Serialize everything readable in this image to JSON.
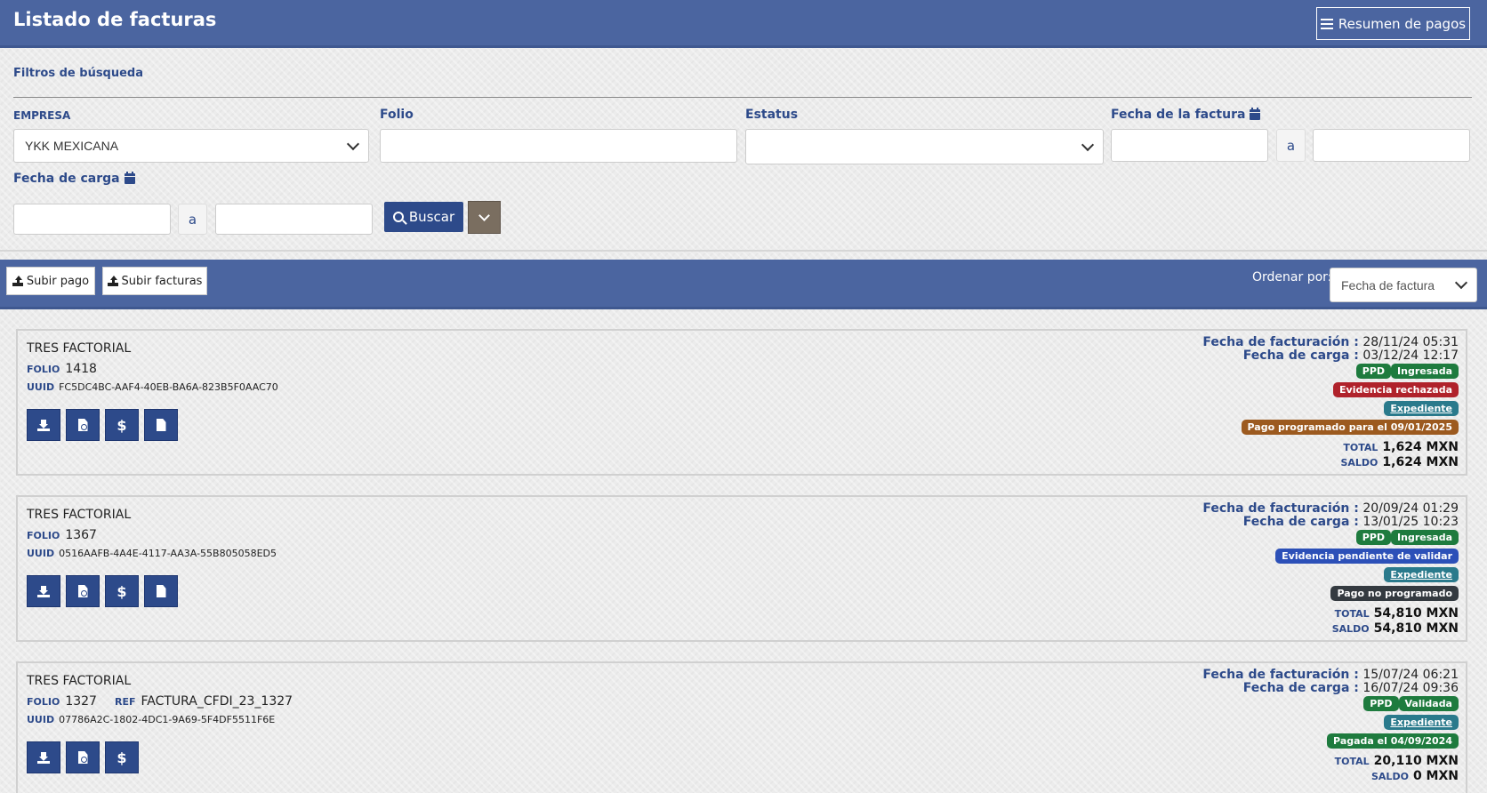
{
  "header": {
    "title": "Listado de facturas",
    "resumen_label": "Resumen de pagos"
  },
  "filters": {
    "section_title": "Filtros de búsqueda",
    "empresa_label": "EMPRESA",
    "empresa_value": "YKK MEXICANA",
    "folio_label": "Folio",
    "folio_value": "",
    "estatus_label": "Estatus",
    "estatus_value": "",
    "fecha_factura_label": "Fecha de la factura",
    "fecha_carga_label": "Fecha de carga",
    "range_sep": "a",
    "buscar_label": "Buscar"
  },
  "toolbar": {
    "subir_pago": "Subir pago",
    "subir_facturas": "Subir facturas",
    "ordenar_label": "Ordenar por:",
    "ordenar_value": "Fecha de factura"
  },
  "labels": {
    "folio": "FOLIO",
    "ref": "REF",
    "uuid": "UUID",
    "fecha_facturacion": "Fecha de facturación :",
    "fecha_carga": "Fecha de carga :",
    "total": "TOTAL",
    "saldo": "SALDO"
  },
  "invoices": [
    {
      "company": "TRES FACTORIAL",
      "folio": "1418",
      "ref": "",
      "uuid": "FC5DC4BC-AAF4-40EB-BA6A-823B5F0AAC70",
      "fecha_facturacion": "28/11/24 05:31",
      "fecha_carga": "03/12/24 12:17",
      "badge_type": "PPD",
      "badge_status": "Ingresada",
      "badge_evidence": "Evidencia rechazada",
      "badge_expediente": "Expediente",
      "badge_pago": "Pago programado para el 09/01/2025",
      "total": "1,624 MXN",
      "saldo": "1,624 MXN"
    },
    {
      "company": "TRES FACTORIAL",
      "folio": "1367",
      "ref": "",
      "uuid": "0516AAFB-4A4E-4117-AA3A-55B805058ED5",
      "fecha_facturacion": "20/09/24 01:29",
      "fecha_carga": "13/01/25 10:23",
      "badge_type": "PPD",
      "badge_status": "Ingresada",
      "badge_evidence": "Evidencia pendiente de validar",
      "badge_expediente": "Expediente",
      "badge_pago": "Pago no programado",
      "total": "54,810 MXN",
      "saldo": "54,810 MXN"
    },
    {
      "company": "TRES FACTORIAL",
      "folio": "1327",
      "ref": "FACTURA_CFDI_23_1327",
      "uuid": "07786A2C-1802-4DC1-9A69-5F4DF5511F6E",
      "fecha_facturacion": "15/07/24 06:21",
      "fecha_carga": "16/07/24 09:36",
      "badge_type": "PPD",
      "badge_status": "Validada",
      "badge_expediente": "Expediente",
      "badge_pago": "Pagada el 04/09/2024",
      "total": "20,110 MXN",
      "saldo": "0 MXN"
    }
  ],
  "colors": {
    "primary": "#4b65a0",
    "label_blue": "#2d4a8a",
    "green": "#1e7b3e",
    "red": "#b0222b",
    "teal": "#2a7a8c",
    "brown": "#9c5a1f",
    "blue": "#2c50b8",
    "dark": "#343a40"
  },
  "icons": {
    "resumen": "list-icon",
    "calendar": "calendar-icon",
    "search": "search-icon",
    "upload": "upload-icon",
    "download": "download-icon",
    "pdf": "pdf-icon",
    "dollar": "dollar-icon",
    "file": "file-icon",
    "chevron": "chevron-down-icon"
  }
}
